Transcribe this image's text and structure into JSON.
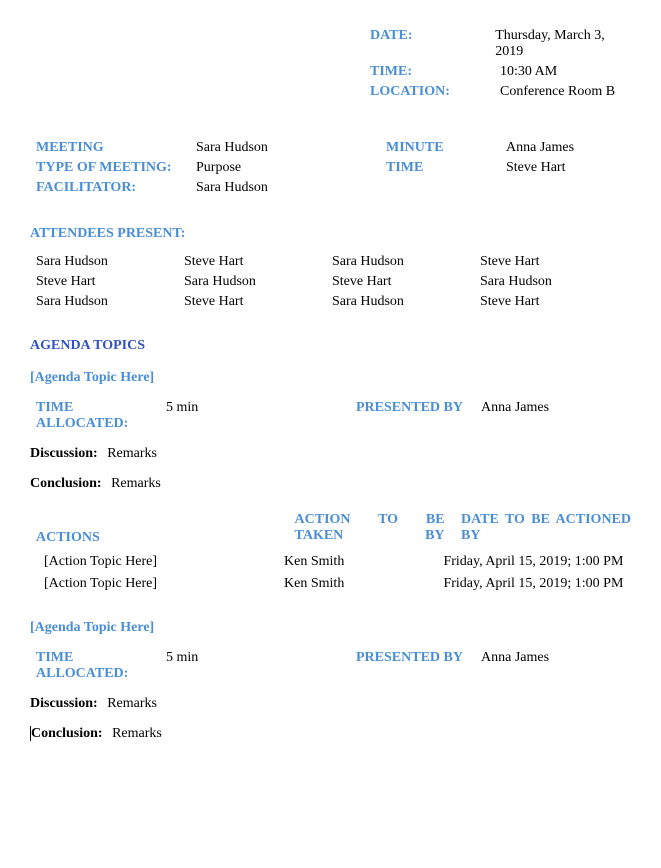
{
  "header": {
    "date_label": "DATE:",
    "date_value": "Thursday, March 3, 2019",
    "time_label": "TIME:",
    "time_value": "10:30 AM",
    "location_label": "LOCATION:",
    "location_value": "Conference Room B"
  },
  "meta": {
    "meeting_label": "MEETING",
    "meeting_value": "Sara Hudson",
    "minute_label": "MINUTE",
    "minute_value": "Anna James",
    "type_label": "TYPE OF MEETING:",
    "type_value": "Purpose",
    "time_label": "TIME",
    "time_value": "Steve Hart",
    "facilitator_label": "FACILITATOR:",
    "facilitator_value": "Sara Hudson"
  },
  "attendees_label": "ATTENDEES PRESENT:",
  "attendees": [
    [
      "Sara Hudson",
      "Steve Hart",
      "Sara Hudson",
      "Steve Hart"
    ],
    [
      "Steve Hart",
      "Sara Hudson",
      "Steve Hart",
      "Sara Hudson"
    ],
    [
      "Sara Hudson",
      "Steve Hart",
      "Sara Hudson",
      "Steve Hart"
    ]
  ],
  "agenda_label": "AGENDA TOPICS",
  "topics": [
    {
      "title": "[Agenda Topic Here]",
      "time_alloc_label": "TIME ALLOCATED:",
      "time_alloc_value": "5 min",
      "presented_label": "PRESENTED BY",
      "presented_value": "Anna James",
      "discussion_label": "Discussion:",
      "discussion_value": "Remarks",
      "conclusion_label": "Conclusion:",
      "conclusion_value": "Remarks"
    },
    {
      "title": "[Agenda Topic Here]",
      "time_alloc_label": "TIME ALLOCATED:",
      "time_alloc_value": "5 min",
      "presented_label": "PRESENTED BY",
      "presented_value": "Anna James",
      "discussion_label": "Discussion:",
      "discussion_value": "Remarks",
      "conclusion_label": "Conclusion:",
      "conclusion_value": "Remarks"
    }
  ],
  "actions": {
    "col1_label": "ACTIONS",
    "col2_label": "ACTION TO BE TAKEN BY",
    "col3_label": "DATE TO BE ACTIONED BY",
    "rows": [
      {
        "topic": "[Action Topic Here]",
        "by": "Ken Smith",
        "date": "Friday, April 15, 2019; 1:00 PM"
      },
      {
        "topic": "[Action Topic Here]",
        "by": "Ken Smith",
        "date": "Friday, April 15, 2019; 1:00 PM"
      }
    ]
  }
}
